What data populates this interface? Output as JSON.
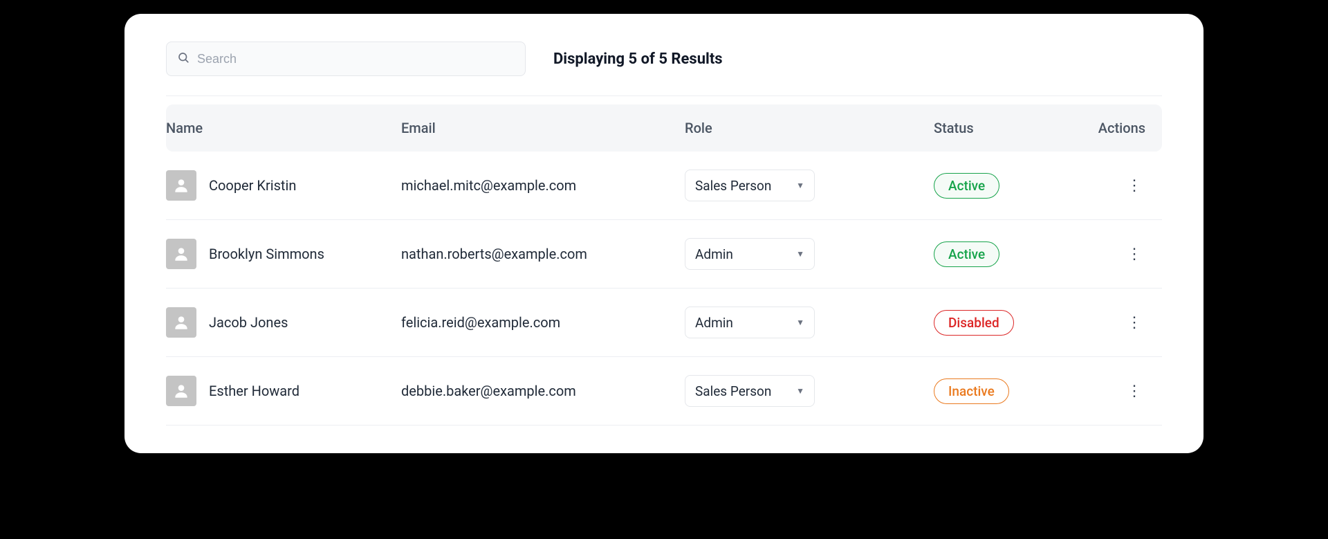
{
  "search": {
    "placeholder": "Search",
    "value": ""
  },
  "results_text": "Displaying 5 of 5 Results",
  "columns": {
    "name": "Name",
    "email": "Email",
    "role": "Role",
    "status": "Status",
    "actions": "Actions"
  },
  "status_styles": {
    "Active": "badge-active",
    "Disabled": "badge-disabled",
    "Inactive": "badge-inactive"
  },
  "rows": [
    {
      "name": "Cooper Kristin",
      "email": "michael.mitc@example.com",
      "role": "Sales Person",
      "status": "Active"
    },
    {
      "name": "Brooklyn Simmons",
      "email": "nathan.roberts@example.com",
      "role": "Admin",
      "status": "Active"
    },
    {
      "name": "Jacob Jones",
      "email": "felicia.reid@example.com",
      "role": "Admin",
      "status": "Disabled"
    },
    {
      "name": "Esther Howard",
      "email": "debbie.baker@example.com",
      "role": "Sales Person",
      "status": "Inactive"
    }
  ]
}
